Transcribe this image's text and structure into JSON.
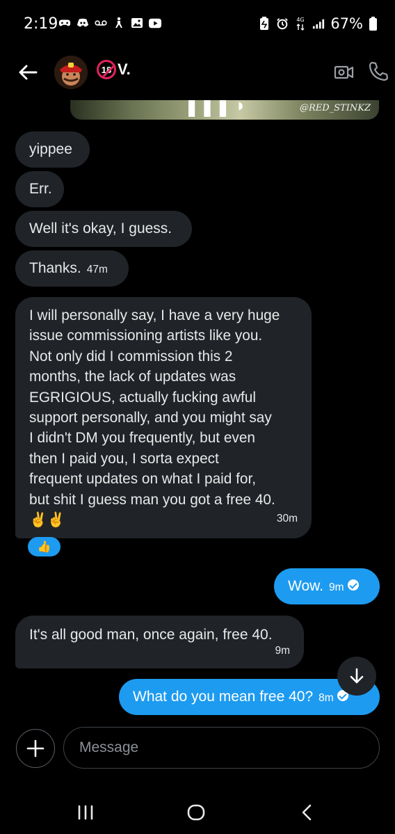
{
  "status_bar": {
    "time": "2:19",
    "battery": "67%",
    "left_icons": [
      "gamepad-icon",
      "discord-icon",
      "voicemail-icon",
      "accessibility-icon",
      "gallery-icon",
      "youtube-icon"
    ],
    "right_icons": [
      "battery-saver-icon",
      "alarm-icon",
      "data-icon",
      "signal-icon",
      "battery-icon"
    ]
  },
  "header": {
    "name": "V.",
    "age_badge": "18",
    "icons": [
      "back-arrow-icon",
      "video-call-icon",
      "phone-icon"
    ]
  },
  "image_preview": {
    "watermark": "@RED_STINKZ"
  },
  "messages": [
    {
      "dir": "in",
      "text": "yippee",
      "time": ""
    },
    {
      "dir": "in",
      "text": "Err.",
      "time": ""
    },
    {
      "dir": "in",
      "text": "Well it's okay, I guess.",
      "time": ""
    },
    {
      "dir": "in",
      "text": "Thanks.",
      "time": "47m"
    },
    {
      "dir": "in",
      "text": "I will personally say, I have a very huge\nissue commissioning artists like you.\nNot only did I commission this 2\nmonths, the lack of updates was\nEGRIGIOUS, actually fucking awful\nsupport personally, and you might say\nI didn't DM you frequently, but even\nthen I paid you, I sorta expect\nfrequent updates on what I paid for,\nbut shit I guess man you got a free 40.\n✌️✌️",
      "time": "30m",
      "reaction": "👍"
    },
    {
      "dir": "out",
      "text": "Wow.",
      "time": "9m"
    },
    {
      "dir": "in",
      "text": "It's all good man, once again, free 40.",
      "time": "9m"
    },
    {
      "dir": "out",
      "text": "What do you mean free 40?",
      "time": "8m"
    }
  ],
  "composer": {
    "placeholder": "Message"
  },
  "colors": {
    "background": "#000000",
    "incoming_bubble": "#202327",
    "outgoing_bubble": "#1d9bf0",
    "text": "#e7e9ea"
  }
}
